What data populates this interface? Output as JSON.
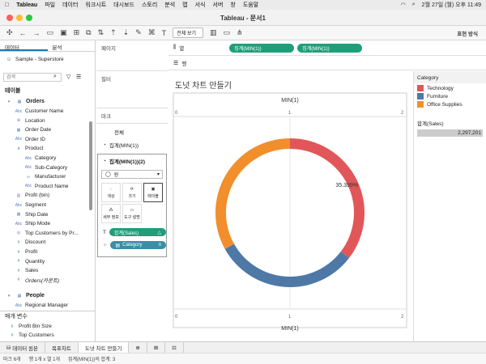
{
  "menubar": {
    "app": "Tableau",
    "items": [
      "파일",
      "데이터",
      "워크시트",
      "대시보드",
      "스토리",
      "분석",
      "맵",
      "서식",
      "서버",
      "창",
      "도움말"
    ],
    "datetime": "2월 27일 (월) 오후 11:49"
  },
  "window": {
    "title": "Tableau - 문서1"
  },
  "toolbar": {
    "view_select": "전체 보기",
    "show_me": "표현 방식"
  },
  "left": {
    "tab_data": "데이터",
    "tab_analysis": "분석",
    "datasource": "Sample - Superstore",
    "search_placeholder": "검색",
    "tables_header": "테이블",
    "orders": "Orders",
    "fields": [
      {
        "label": "Customer Name",
        "type": "Abc"
      },
      {
        "label": "Location",
        "type": "geo"
      },
      {
        "label": "Order Date",
        "type": "date"
      },
      {
        "label": "Order ID",
        "type": "Abc"
      },
      {
        "label": "Product",
        "type": "hier"
      },
      {
        "label": "Category",
        "type": "Abc"
      },
      {
        "label": "Sub-Category",
        "type": "Abc"
      },
      {
        "label": "Manufacturer",
        "type": "link"
      },
      {
        "label": "Product Name",
        "type": "Abc"
      },
      {
        "label": "Profit (bin)",
        "type": "bin"
      },
      {
        "label": "Segment",
        "type": "Abc"
      },
      {
        "label": "Ship Date",
        "type": "date"
      },
      {
        "label": "Ship Mode",
        "type": "Abc"
      },
      {
        "label": "Top Customers by Pr...",
        "type": "set"
      },
      {
        "label": "Discount",
        "type": "#"
      },
      {
        "label": "Profit",
        "type": "#"
      },
      {
        "label": "Quantity",
        "type": "#"
      },
      {
        "label": "Sales",
        "type": "#"
      },
      {
        "label": "Orders(카운트)",
        "type": "#"
      }
    ],
    "people": "People",
    "regional_manager": "Regional Manager",
    "params_header": "매개 변수",
    "params": [
      "Profit Bin Size",
      "Top Customers"
    ]
  },
  "shelves": {
    "pages": "페이지",
    "filters": "필터",
    "marks": "마크",
    "marks_all": "전체",
    "marks_1": "집계(MIN(1))",
    "marks_2": "집계(MIN(1))(2)",
    "mark_type": "원",
    "btn_color": "색상",
    "btn_size": "크기",
    "btn_label": "레이블",
    "btn_detail": "세부 정보",
    "btn_tooltip": "도구 설명",
    "pill_sales": "합계(Sales)",
    "pill_category": "Category",
    "columns_label": "열",
    "rows_label": "행",
    "col_pill_1": "집계(MIN(1))",
    "col_pill_2": "집계(MIN(1))"
  },
  "view": {
    "title": "도넛 차트 만들기",
    "axis_title": "MIN(1)",
    "tick_0": "0",
    "tick_1": "1",
    "tick_2": "2",
    "label_pct": "35.399%"
  },
  "legend": {
    "title": "Category",
    "items": [
      {
        "label": "Technology",
        "color": "#e15759"
      },
      {
        "label": "Furniture",
        "color": "#4e79a7"
      },
      {
        "label": "Office Supplies",
        "color": "#f28e2b"
      }
    ],
    "size_title": "합계(Sales)",
    "size_value": "2,297,201"
  },
  "bottom": {
    "tabs": [
      "데이터 원본",
      "목표차트",
      "도넛 차트 만들기"
    ],
    "status_marks": "마크 6개",
    "status_rows": "행 1개 x 열 1개",
    "status_sum": "집계(MIN(1))의 합계: 3"
  },
  "chart_data": {
    "type": "pie",
    "categories": [
      "Technology",
      "Furniture",
      "Office Supplies"
    ],
    "values": [
      35.399,
      31.5,
      33.101
    ],
    "colors": [
      "#e15759",
      "#4e79a7",
      "#f28e2b"
    ],
    "donut": true,
    "label": "35.399%",
    "xlabel": "MIN(1)"
  }
}
